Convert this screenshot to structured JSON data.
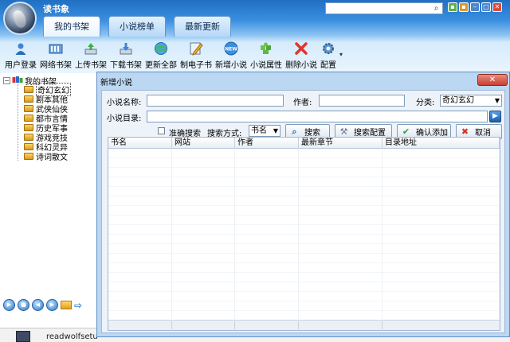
{
  "app": {
    "title": "读书象"
  },
  "tabs": [
    {
      "label": "我的书架",
      "active": true
    },
    {
      "label": "小说榜单",
      "active": false
    },
    {
      "label": "最新更新",
      "active": false
    }
  ],
  "toolbar": [
    {
      "label": "用户登录",
      "icon": "user-icon"
    },
    {
      "label": "网络书架",
      "icon": "network-shelf-icon"
    },
    {
      "label": "上传书架",
      "icon": "upload-icon"
    },
    {
      "label": "下载书架",
      "icon": "download-icon"
    },
    {
      "label": "更新全部",
      "icon": "refresh-globe-icon"
    },
    {
      "label": "制电子书",
      "icon": "make-ebook-icon"
    },
    {
      "label": "新增小说",
      "icon": "new-badge-icon"
    },
    {
      "label": "小说属性",
      "icon": "puzzle-icon"
    },
    {
      "label": "删除小说",
      "icon": "delete-x-icon"
    },
    {
      "label": "配置",
      "icon": "gear-icon"
    }
  ],
  "tree": {
    "root": "我的书架",
    "items": [
      "奇幻玄幻",
      "剧本其他",
      "武侠仙侠",
      "都市言情",
      "历史军事",
      "游戏竞技",
      "科幻灵异",
      "诗词散文"
    ],
    "selected_index": 0
  },
  "dialog": {
    "title": "新增小说",
    "close_label": "✕",
    "name_label": "小说名称:",
    "author_label": "作者:",
    "category_label": "分类:",
    "category_value": "奇幻玄幻",
    "dir_label": "小说目录:",
    "exact_search_label": "准确搜索",
    "search_mode_label": "搜索方式:",
    "search_mode_value": "书名",
    "search_button": "搜索",
    "search_config_button": "搜索配置",
    "confirm_button": "确认添加",
    "cancel_button": "取消",
    "columns": [
      "书名",
      "网站",
      "作者",
      "最新章节",
      "目录地址"
    ]
  },
  "taskbar": {
    "label": "readwolfsetu"
  },
  "colors": {
    "accent": "#2d78c9",
    "title_bar": "#1f6fc3",
    "dialog_frame": "#bcd7f2"
  }
}
